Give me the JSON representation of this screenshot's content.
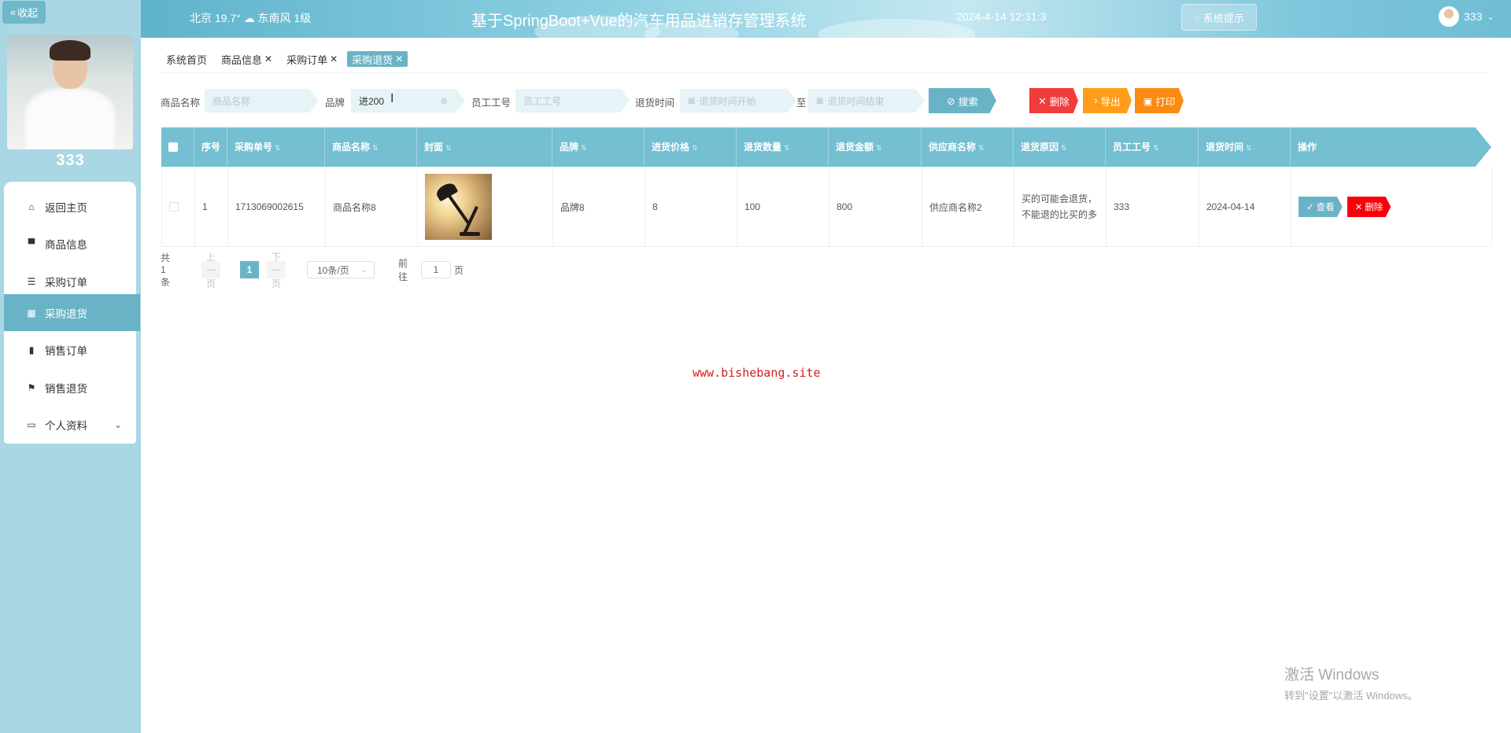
{
  "sidebar": {
    "collapse_label": "收起",
    "user_name": "333",
    "menu": [
      {
        "label": "返回主页",
        "icon": "home-icon",
        "glyph": "⌂"
      },
      {
        "label": "商品信息",
        "icon": "monitor-icon",
        "glyph": "▀"
      },
      {
        "label": "采购订单",
        "icon": "sliders-icon",
        "glyph": "☰"
      },
      {
        "label": "采购退货",
        "icon": "grid-icon",
        "glyph": "▦",
        "active": true
      },
      {
        "label": "销售订单",
        "icon": "clipboard-icon",
        "glyph": "▮"
      },
      {
        "label": "销售退货",
        "icon": "flag-icon",
        "glyph": "⚑"
      },
      {
        "label": "个人资料",
        "icon": "card-icon",
        "glyph": "▭",
        "expandable": true
      }
    ]
  },
  "header": {
    "weather": "北京  19.7°  ☁  东南风  1级",
    "title": "基于SpringBoot+Vue的汽车用品进销存管理系统",
    "datetime": "2024-4-14 12:31:3",
    "notice_label": "系统提示",
    "user_name": "333"
  },
  "tabs": [
    {
      "label": "系统首页",
      "closable": false
    },
    {
      "label": "商品信息",
      "closable": true
    },
    {
      "label": "采购订单",
      "closable": true
    },
    {
      "label": "采购退货",
      "closable": true,
      "active": true
    }
  ],
  "search": {
    "product_name_label": "商品名称",
    "product_name_placeholder": "商品名称",
    "brand_label": "品牌",
    "brand_value": "进200",
    "employee_label": "员工工号",
    "employee_placeholder": "员工工号",
    "return_time_label": "退货时间",
    "time_start_placeholder": "退货时间开始",
    "to_label": "至",
    "time_end_placeholder": "退货时间结束",
    "search_label": "搜索",
    "delete_label": "删除",
    "export_label": "导出",
    "print_label": "打印"
  },
  "table": {
    "headers": [
      "序号",
      "采购单号",
      "商品名称",
      "封面",
      "品牌",
      "进货价格",
      "退货数量",
      "退货金额",
      "供应商名称",
      "退货原因",
      "员工工号",
      "退货时间",
      "操作"
    ],
    "rows": [
      {
        "index": "1",
        "order_no": "1713069002615",
        "product_name": "商品名称8",
        "brand": "品牌8",
        "price": "8",
        "quantity": "100",
        "amount": "800",
        "supplier": "供应商名称2",
        "reason": "买的可能会退货，\n不能退的比买的多",
        "employee": "333",
        "date": "2024-04-14",
        "view_label": "查看",
        "delete_label": "删除"
      }
    ]
  },
  "pager": {
    "total": "共 1 条",
    "prev": "上一页",
    "page": "1",
    "next": "下一页",
    "size": "10条/页",
    "goto": "前往",
    "goto_value": "1",
    "page_unit": "页"
  },
  "watermark": "www.bishebang.site",
  "windows_activation": {
    "line1": "激活 Windows",
    "line2": "转到\"设置\"以激活 Windows。"
  }
}
